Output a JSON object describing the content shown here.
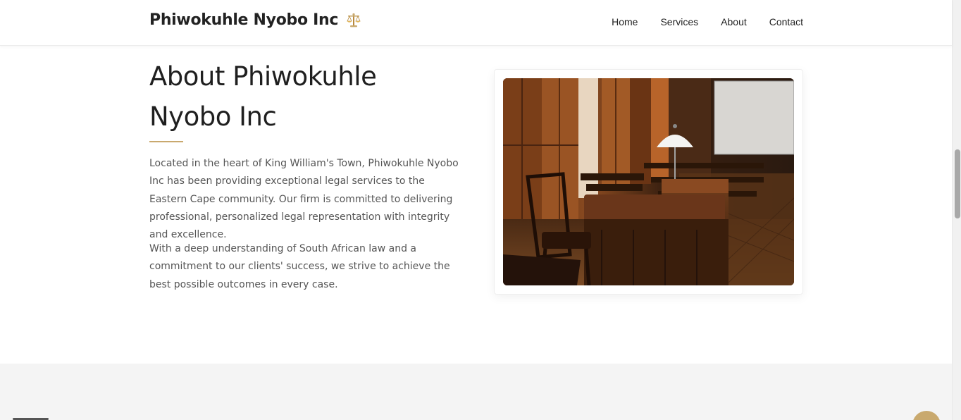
{
  "header": {
    "brand": "Phiwokuhle Nyobo Inc",
    "brand_icon": "scales-icon",
    "nav": [
      {
        "label": "Home"
      },
      {
        "label": "Services"
      },
      {
        "label": "About"
      },
      {
        "label": "Contact"
      }
    ]
  },
  "about": {
    "title": "About Phiwokuhle Nyobo Inc",
    "paragraph_1": "Located in the heart of King William's Town, Phiwokuhle Nyobo Inc has been providing exceptional legal services to the Eastern Cape community. Our firm is committed to delivering professional, personalized legal representation with integrity and excellence.",
    "paragraph_2": "With a deep understanding of South African law and a commitment to our clients' success, we strive to achieve the best possible outcomes in every case.",
    "image": "courtroom-photo"
  },
  "colors": {
    "accent": "#c9a96e",
    "text": "#222222",
    "muted": "#555555",
    "band": "#f4f4f4"
  }
}
